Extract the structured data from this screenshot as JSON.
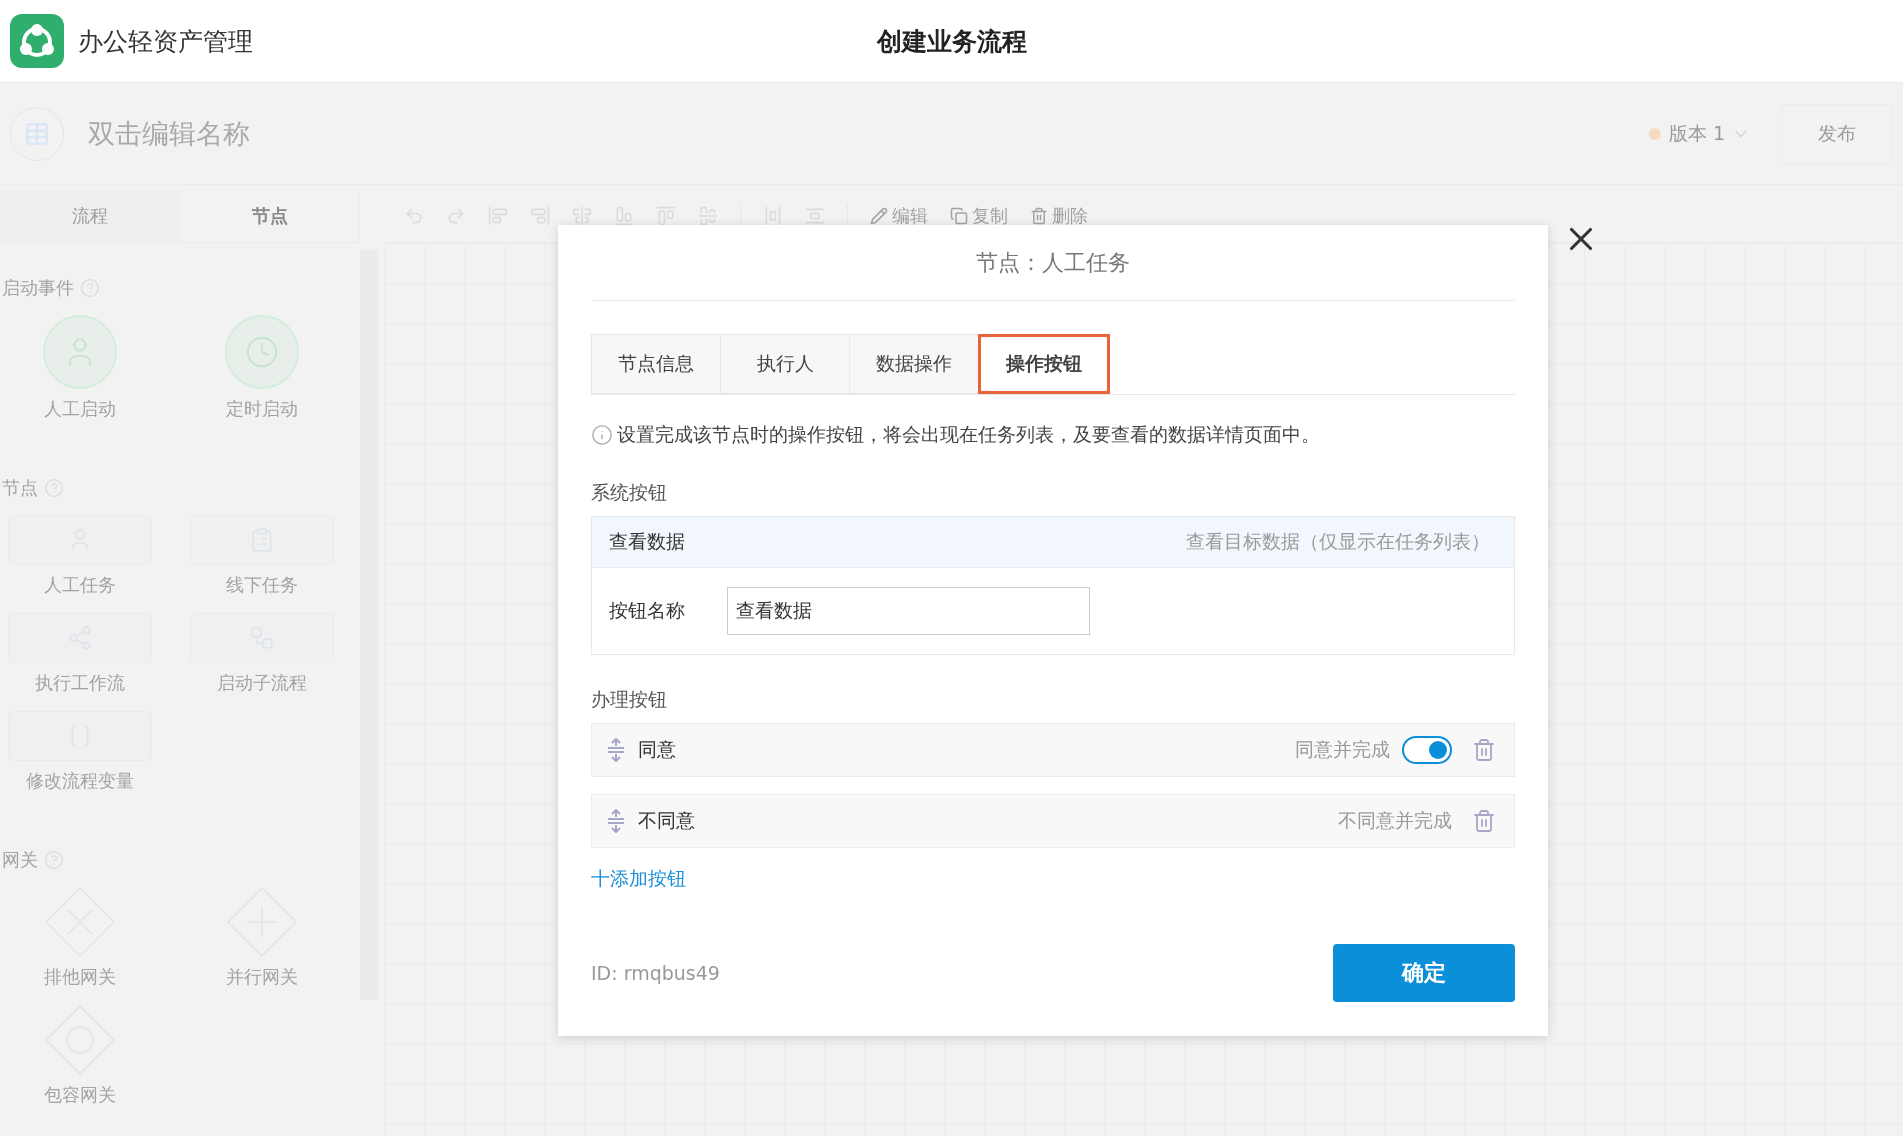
{
  "header": {
    "app_name": "办公轻资产管理",
    "title": "创建业务流程"
  },
  "flow_bar": {
    "name_placeholder": "双击编辑名称",
    "version": "版本 1",
    "publish": "发布"
  },
  "sidebar": {
    "tabs": [
      {
        "label": "流程",
        "selected": false
      },
      {
        "label": "节点",
        "selected": true
      }
    ],
    "sections": [
      {
        "title": "启动事件",
        "items": [
          {
            "label": "人工启动",
            "kind": "event"
          },
          {
            "label": "定时启动",
            "kind": "event"
          }
        ]
      },
      {
        "title": "节点",
        "items": [
          {
            "label": "人工任务",
            "kind": "task"
          },
          {
            "label": "线下任务",
            "kind": "task"
          },
          {
            "label": "执行工作流",
            "kind": "task"
          },
          {
            "label": "启动子流程",
            "kind": "task"
          },
          {
            "label": "修改流程变量",
            "kind": "task"
          }
        ]
      },
      {
        "title": "网关",
        "items": [
          {
            "label": "排他网关",
            "kind": "gateway"
          },
          {
            "label": "并行网关",
            "kind": "gateway"
          },
          {
            "label": "包容网关",
            "kind": "gateway"
          }
        ]
      }
    ]
  },
  "toolbar": {
    "actions": [
      "编辑",
      "复制",
      "删除"
    ]
  },
  "dialog": {
    "title": "节点：人工任务",
    "tabs": [
      {
        "label": "节点信息",
        "selected": false
      },
      {
        "label": "执行人",
        "selected": false
      },
      {
        "label": "数据操作",
        "selected": false
      },
      {
        "label": "操作按钮",
        "selected": true
      }
    ],
    "info": "设置完成该节点时的操作按钮，将会出现在任务列表，及要查看的数据详情页面中。",
    "system": {
      "title": "系统按钮",
      "name": "查看数据",
      "description": "查看目标数据（仅显示在任务列表）",
      "field_label": "按钮名称",
      "field_value": "查看数据"
    },
    "actions": {
      "title": "办理按钮",
      "rows": [
        {
          "label": "同意",
          "description": "同意并完成",
          "kind": "toggle",
          "on": true
        },
        {
          "label": "不同意",
          "description": "不同意并完成",
          "kind": "plain"
        }
      ],
      "add": "十添加按钮"
    },
    "id": "ID: rmqbus49",
    "confirm": "确定"
  }
}
